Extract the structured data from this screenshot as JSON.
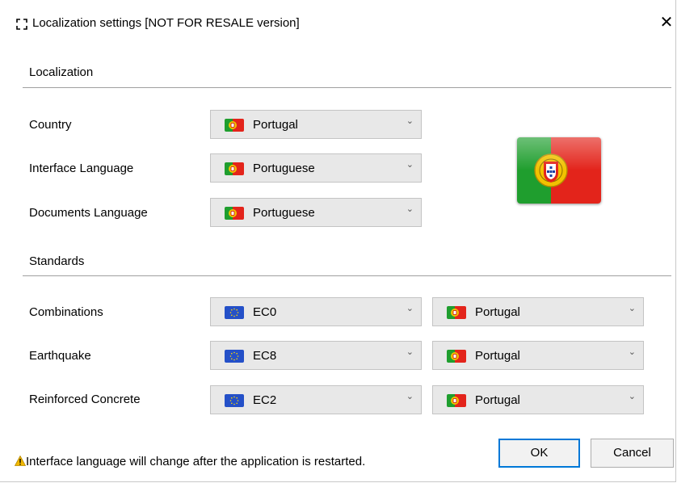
{
  "window": {
    "title": "Localization settings [NOT FOR RESALE version]",
    "close_glyph": "✕",
    "app_icon": "brackets-icon"
  },
  "localization": {
    "heading": "Localization",
    "rows": [
      {
        "label": "Country",
        "value": "Portugal",
        "flag": "portugal-flag-icon"
      },
      {
        "label": "Interface Language",
        "value": "Portuguese",
        "flag": "portugal-flag-icon"
      },
      {
        "label": "Documents Language",
        "value": "Portuguese",
        "flag": "portugal-flag-icon"
      }
    ],
    "large_flag": "portugal-flag"
  },
  "standards": {
    "heading": "Standards",
    "rows": [
      {
        "label": "Combinations",
        "code": "EC0",
        "code_flag": "eu-flag-icon",
        "annex": "Portugal",
        "annex_flag": "portugal-flag-icon"
      },
      {
        "label": "Earthquake",
        "code": "EC8",
        "code_flag": "eu-flag-icon",
        "annex": "Portugal",
        "annex_flag": "portugal-flag-icon"
      },
      {
        "label": "Reinforced Concrete",
        "code": "EC2",
        "code_flag": "eu-flag-icon",
        "annex": "Portugal",
        "annex_flag": "portugal-flag-icon"
      }
    ]
  },
  "footer": {
    "warning": "Interface language will change after the application is restarted.",
    "ok_label": "OK",
    "cancel_label": "Cancel"
  },
  "colors": {
    "accent_focus": "#0078d7",
    "portugal_green": "#1f9e2e",
    "portugal_red": "#e3241b",
    "eu_blue": "#2450c8",
    "warning_yellow": "#f2b800"
  }
}
